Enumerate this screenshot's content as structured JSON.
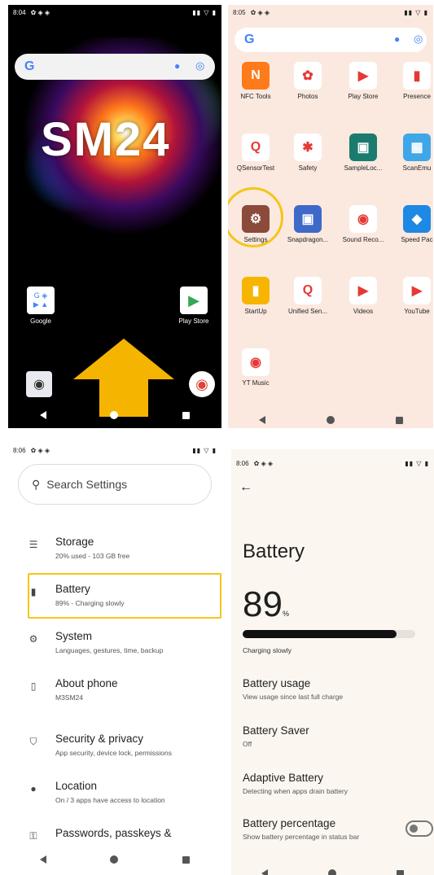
{
  "panel1": {
    "status_time": "8:04",
    "status_right": "▮▮ ▽ ▮",
    "brand": "SM24",
    "google_folder_label": "Google",
    "play_store_label": "Play Store"
  },
  "panel2": {
    "status_time": "8:05",
    "status_right": "▮▮ ▽ ▮",
    "apps": [
      {
        "label": "NFC Tools",
        "color": "#ff7a1a",
        "glyph": "N"
      },
      {
        "label": "Photos",
        "color": "#ffffff",
        "glyph": "✿"
      },
      {
        "label": "Play Store",
        "color": "#ffffff",
        "glyph": "▶"
      },
      {
        "label": "Presence",
        "color": "#ffffff",
        "glyph": "▮"
      },
      {
        "label": "QSensorTest",
        "color": "#ffffff",
        "glyph": "Q"
      },
      {
        "label": "Safety",
        "color": "#ffffff",
        "glyph": "✱"
      },
      {
        "label": "SampleLoc...",
        "color": "#1b7b6e",
        "glyph": "▣"
      },
      {
        "label": "ScanEmu",
        "color": "#3fa7e8",
        "glyph": "▦"
      },
      {
        "label": "Settings",
        "color": "#8b4a3a",
        "glyph": "⚙"
      },
      {
        "label": "Snapdragon...",
        "color": "#3f69c9",
        "glyph": "▣"
      },
      {
        "label": "Sound Reco...",
        "color": "#ffffff",
        "glyph": "◉"
      },
      {
        "label": "Speed Pac",
        "color": "#1e88e5",
        "glyph": "◆"
      },
      {
        "label": "StartUp",
        "color": "#f7b500",
        "glyph": "▮"
      },
      {
        "label": "Unified Sen...",
        "color": "#ffffff",
        "glyph": "Q"
      },
      {
        "label": "Videos",
        "color": "#ffffff",
        "glyph": "▶"
      },
      {
        "label": "YouTube",
        "color": "#ffffff",
        "glyph": "▶"
      },
      {
        "label": "YT Music",
        "color": "#ffffff",
        "glyph": "◉"
      }
    ]
  },
  "panel3": {
    "status_time": "8:06",
    "status_right": "▮▮ ▽ ▮",
    "search_placeholder": "Search Settings",
    "rows": [
      {
        "title": "Storage",
        "sub": "20% used - 103 GB free",
        "icon": "☰"
      },
      {
        "title": "Battery",
        "sub": "89% - Charging slowly",
        "icon": "▮"
      },
      {
        "title": "System",
        "sub": "Languages, gestures, time, backup",
        "icon": "⚙"
      },
      {
        "title": "About phone",
        "sub": "M3SM24",
        "icon": "▯"
      },
      {
        "title": "Security & privacy",
        "sub": "App security, device lock, permissions",
        "icon": "⛉"
      },
      {
        "title": "Location",
        "sub": "On / 3 apps have access to location",
        "icon": "●"
      },
      {
        "title": "Passwords, passkeys &",
        "sub": "",
        "icon": "⚿"
      }
    ]
  },
  "panel4": {
    "status_time": "8:06",
    "status_right": "▮▮ ▽ ▮",
    "back_icon": "←",
    "title": "Battery",
    "percent": "89",
    "percent_unit": "%",
    "level_fraction": 0.89,
    "charging_text": "Charging slowly",
    "rows": [
      {
        "title": "Battery usage",
        "sub": "View usage since last full charge"
      },
      {
        "title": "Battery Saver",
        "sub": "Off"
      },
      {
        "title": "Adaptive Battery",
        "sub": "Detecting when apps drain battery"
      },
      {
        "title": "Battery percentage",
        "sub": "Show battery percentage in status bar"
      }
    ]
  }
}
